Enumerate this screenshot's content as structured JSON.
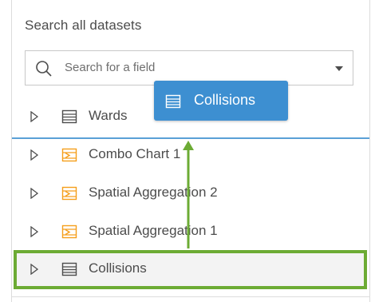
{
  "panel": {
    "heading": "Search all datasets",
    "search": {
      "placeholder": "Search for a field"
    },
    "datasets": [
      {
        "label": "Wards",
        "icon": "table-icon"
      },
      {
        "label": "Combo Chart 1",
        "icon": "result-dataset-icon"
      },
      {
        "label": "Spatial Aggregation 2",
        "icon": "result-dataset-icon"
      },
      {
        "label": "Spatial Aggregation 1",
        "icon": "result-dataset-icon"
      },
      {
        "label": "Collisions",
        "icon": "table-icon"
      }
    ]
  },
  "drag_chip": {
    "label": "Collisions",
    "icon": "table-icon"
  },
  "colors": {
    "accent_blue": "#3d8fd1",
    "highlight_green": "#6cab34",
    "result_icon_orange": "#f59e1b",
    "separator_blue": "#5aa0d6"
  }
}
